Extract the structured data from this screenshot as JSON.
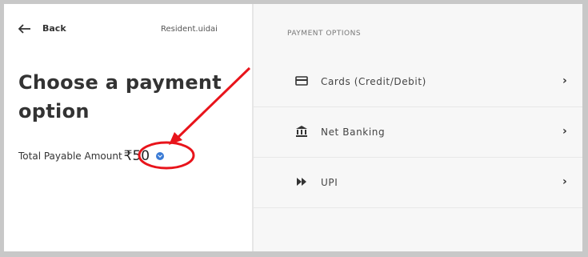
{
  "header": {
    "back_label": "Back",
    "merchant": "Resident.uidai"
  },
  "title": "Choose a payment option",
  "amount": {
    "label": "Total Payable Amount",
    "value": "₹50"
  },
  "payment": {
    "section_title": "PAYMENT OPTIONS",
    "options": [
      {
        "label": "Cards (Credit/Debit)",
        "icon": "card-icon"
      },
      {
        "label": "Net Banking",
        "icon": "bank-icon"
      },
      {
        "label": "UPI",
        "icon": "upi-icon"
      }
    ]
  },
  "colors": {
    "annotation": "#e8141b",
    "info": "#3a7bd5"
  }
}
